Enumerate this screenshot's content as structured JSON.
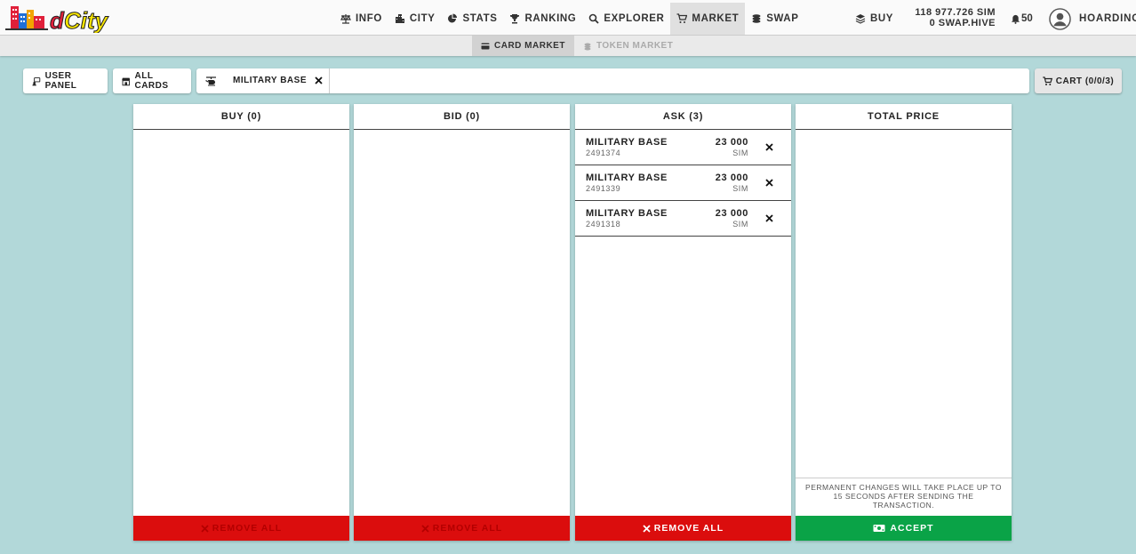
{
  "header": {
    "nav": [
      {
        "label": "INFO",
        "icon": "balance-scale-icon",
        "active": false
      },
      {
        "label": "CITY",
        "icon": "city-icon",
        "active": false
      },
      {
        "label": "STATS",
        "icon": "pie-chart-icon",
        "active": false
      },
      {
        "label": "RANKING",
        "icon": "trophy-icon",
        "active": false
      },
      {
        "label": "EXPLORER",
        "icon": "search-icon",
        "active": false
      },
      {
        "label": "MARKET",
        "icon": "cart-icon",
        "active": true
      },
      {
        "label": "SWAP",
        "icon": "coins-icon",
        "active": false
      }
    ],
    "buy_label": "BUY",
    "balance_sim": "118 977.726 SIM",
    "balance_swap": "0 SWAP.HIVE",
    "notifications": "50",
    "username": "HOARDING"
  },
  "subnav": {
    "tabs": [
      {
        "label": "CARD MARKET",
        "active": true
      },
      {
        "label": "TOKEN MARKET",
        "active": false,
        "disabled": true
      }
    ]
  },
  "toolbar": {
    "user_panel": "USER PANEL",
    "all_cards": "ALL CARDS",
    "filter_chip": "MILITARY BASE",
    "search_value": "",
    "cart": "CART (0/0/3)"
  },
  "panels": {
    "buy": {
      "title": "BUY (0)",
      "remove_all": "REMOVE ALL"
    },
    "bid": {
      "title": "BID (0)",
      "remove_all": "REMOVE ALL"
    },
    "ask": {
      "title": "ASK (3)",
      "remove_all": "REMOVE ALL",
      "items": [
        {
          "name": "MILITARY BASE",
          "id": "2491374",
          "price": "23 000",
          "unit": "SIM"
        },
        {
          "name": "MILITARY BASE",
          "id": "2491339",
          "price": "23 000",
          "unit": "SIM"
        },
        {
          "name": "MILITARY BASE",
          "id": "2491318",
          "price": "23 000",
          "unit": "SIM"
        }
      ]
    },
    "total": {
      "title": "TOTAL PRICE",
      "notice": "PERMANENT CHANGES WILL TAKE PLACE UP TO 15 SECONDS AFTER SENDING THE TRANSACTION.",
      "accept": "ACCEPT"
    }
  },
  "colors": {
    "background": "#b2d8d9",
    "danger": "#db0d0d",
    "success": "#0aa347"
  }
}
